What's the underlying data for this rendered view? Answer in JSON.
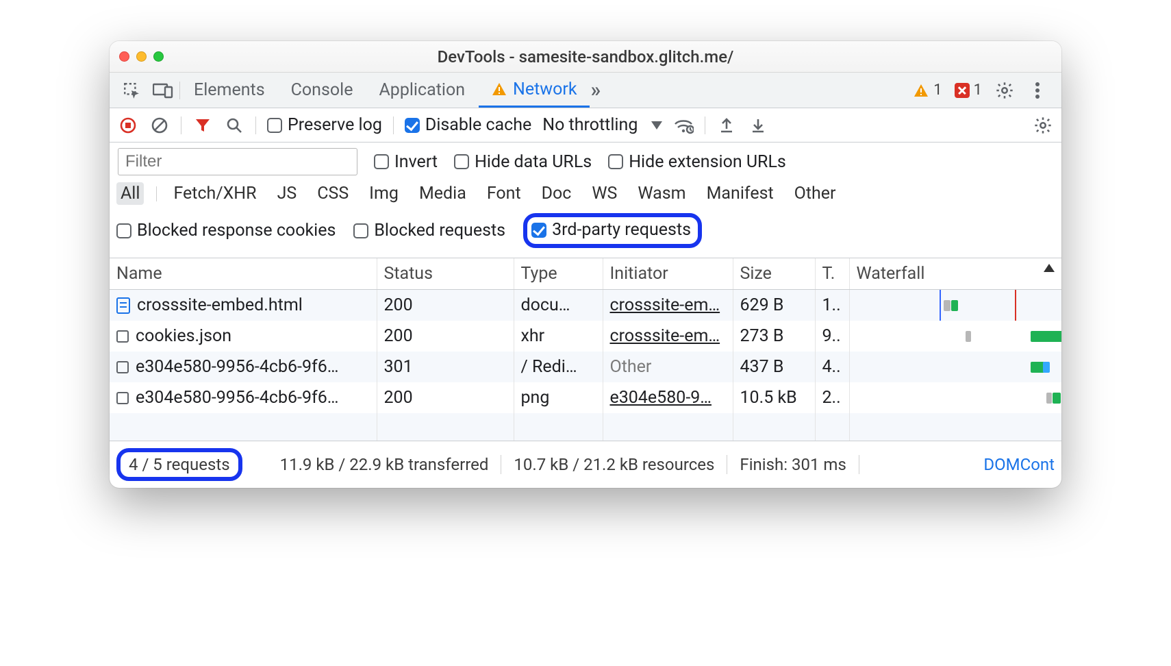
{
  "window": {
    "title": "DevTools - samesite-sandbox.glitch.me/"
  },
  "tabs": {
    "items": [
      "Elements",
      "Console",
      "Application",
      "Network"
    ],
    "active": "Network",
    "warn_count": "1",
    "error_count": "1"
  },
  "toolbar": {
    "preserve_log": "Preserve log",
    "disable_cache": "Disable cache",
    "throttling": "No throttling"
  },
  "filter": {
    "placeholder": "Filter",
    "invert": "Invert",
    "hide_data_urls": "Hide data URLs",
    "hide_ext_urls": "Hide extension URLs"
  },
  "type_filters": [
    "All",
    "Fetch/XHR",
    "JS",
    "CSS",
    "Img",
    "Media",
    "Font",
    "Doc",
    "WS",
    "Wasm",
    "Manifest",
    "Other"
  ],
  "type_active": "All",
  "extra_filters": {
    "blocked_cookies": "Blocked response cookies",
    "blocked_requests": "Blocked requests",
    "thirdparty": "3rd-party requests"
  },
  "columns": [
    "Name",
    "Status",
    "Type",
    "Initiator",
    "Size",
    "T.",
    "Waterfall"
  ],
  "rows": [
    {
      "icon": "doc",
      "name": "crosssite-embed.html",
      "status": "200",
      "type": "docu…",
      "initiator": "crosssite-em…",
      "initiator_link": true,
      "size": "629 B",
      "time": "1.."
    },
    {
      "icon": "box",
      "name": "cookies.json",
      "status": "200",
      "type": "xhr",
      "initiator": "crosssite-em…",
      "initiator_link": true,
      "size": "273 B",
      "time": "9.."
    },
    {
      "icon": "box",
      "name": "e304e580-9956-4cb6-9f6…",
      "status": "301",
      "type": "/ Redi…",
      "initiator": "Other",
      "initiator_link": false,
      "size": "437 B",
      "time": "4.."
    },
    {
      "icon": "box",
      "name": "e304e580-9956-4cb6-9f6…",
      "status": "200",
      "type": "png",
      "initiator": "e304e580-9…",
      "initiator_link": true,
      "size": "10.5 kB",
      "time": "2.."
    }
  ],
  "status": {
    "requests": "4 / 5 requests",
    "transferred": "11.9 kB / 22.9 kB transferred",
    "resources": "10.7 kB / 21.2 kB resources",
    "finish": "Finish: 301 ms",
    "domcontent": "DOMCont"
  }
}
